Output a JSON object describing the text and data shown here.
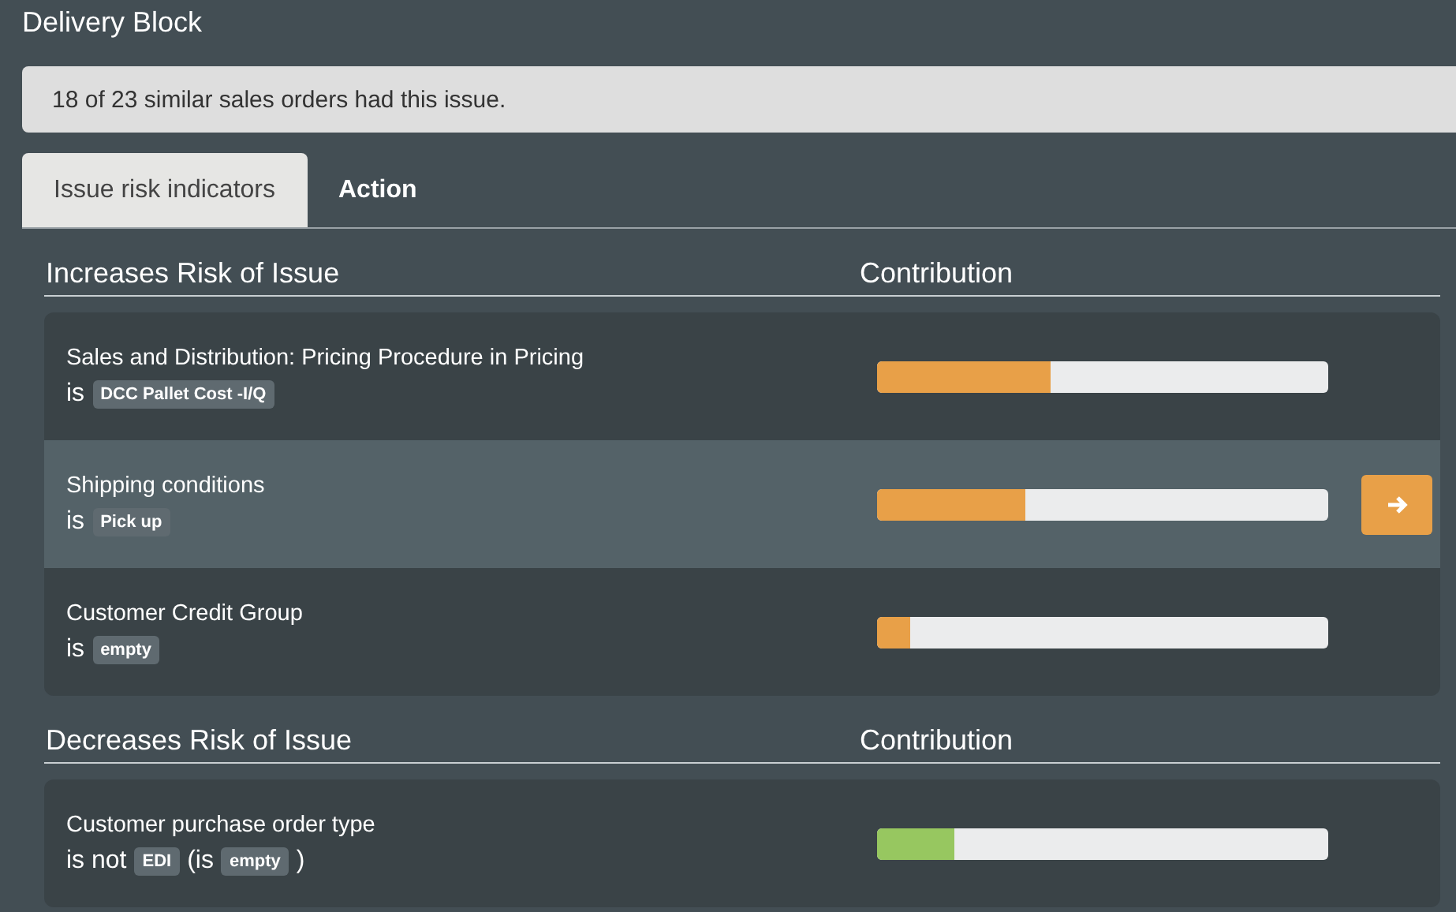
{
  "title": "Delivery Block",
  "summary": "18 of 23 similar sales orders had this issue.",
  "tabs": [
    {
      "label": "Issue risk indicators",
      "selected": true
    },
    {
      "label": "Action",
      "selected": false
    }
  ],
  "sections": [
    {
      "kind": "increase",
      "heading": "Increases Risk of Issue",
      "column": "Contribution",
      "rows": [
        {
          "name": "Sales and Distribution: Pricing Procedure in Pricing",
          "highlighted": false,
          "level": 0.385,
          "condition": [
            {
              "kind": "word",
              "text": "is"
            },
            {
              "kind": "chip",
              "text": "DCC Pallet Cost -I/Q"
            }
          ]
        },
        {
          "name": "Shipping conditions",
          "highlighted": true,
          "level": 0.33,
          "condition": [
            {
              "kind": "word",
              "text": "is"
            },
            {
              "kind": "chip",
              "text": "Pick up"
            }
          ]
        },
        {
          "name": "Customer Credit Group",
          "highlighted": false,
          "level": 0.075,
          "condition": [
            {
              "kind": "word",
              "text": "is"
            },
            {
              "kind": "chip",
              "text": "empty"
            }
          ]
        }
      ]
    },
    {
      "kind": "decrease",
      "heading": "Decreases Risk of Issue",
      "column": "Contribution",
      "rows": [
        {
          "name": "Customer purchase order type",
          "highlighted": false,
          "level": 0.17,
          "condition": [
            {
              "kind": "word",
              "text": "is not"
            },
            {
              "kind": "chip",
              "text": "EDI"
            },
            {
              "kind": "word",
              "text": "(is"
            },
            {
              "kind": "chip",
              "text": "empty"
            },
            {
              "kind": "word",
              "text": ")"
            }
          ]
        }
      ]
    }
  ]
}
